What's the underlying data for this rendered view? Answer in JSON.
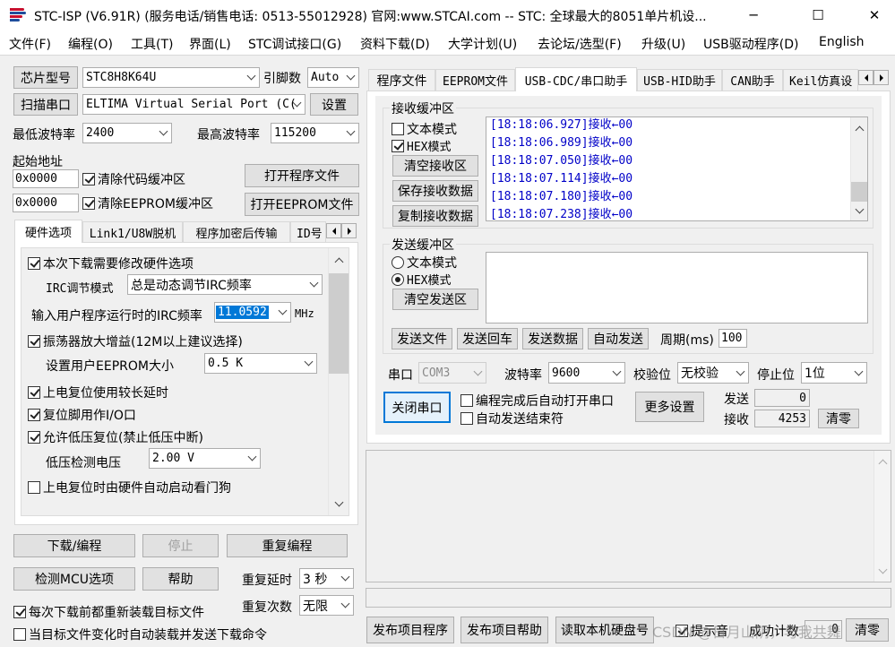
{
  "titlebar": {
    "title": "STC-ISP (V6.91R) (服务电话/销售电话: 0513-55012928) 官网:www.STCAI.com  -- STC: 全球最大的8051单片机设...",
    "minimize": "─",
    "maximize": "☐",
    "close": "✕"
  },
  "menu": [
    "文件(F)",
    "编程(O)",
    "工具(T)",
    "界面(L)",
    "STC调试接口(G)",
    "资料下载(D)",
    "大学计划(U)",
    "去论坛/选型(F)",
    "升级(U)",
    "USB驱动程序(D)",
    "English"
  ],
  "left": {
    "chip_btn": "芯片型号",
    "chip_value": "STC8H8K64U",
    "pin_label": "引脚数",
    "pin_value": "Auto",
    "scan_btn": "扫描串口",
    "port_value": "ELTIMA Virtual Serial Port (C(",
    "settings_btn": "设置",
    "min_baud_label": "最低波特率",
    "min_baud_value": "2400",
    "max_baud_label": "最高波特率",
    "max_baud_value": "115200",
    "start_addr_label": "起始地址",
    "addr1": "0x0000",
    "clear_code_cb": "清除代码缓冲区",
    "open_prog_btn": "打开程序文件",
    "addr2": "0x0000",
    "clear_eeprom_cb": "清除EEPROM缓冲区",
    "open_eeprom_btn": "打开EEPROM文件",
    "tabs": [
      "硬件选项",
      "Link1/U8W脱机",
      "程序加密后传输",
      "ID号"
    ],
    "hw": {
      "opt_modify": "本次下载需要修改硬件选项",
      "irc_mode_label": "IRC调节模式",
      "irc_mode_value": "总是动态调节IRC频率",
      "irc_freq_label": "输入用户程序运行时的IRC频率",
      "irc_freq_value": "11.0592",
      "irc_unit": "MHz",
      "osc_gain": "振荡器放大增益(12M以上建议选择)",
      "eeprom_size_label": "设置用户EEPROM大小",
      "eeprom_size_value": "0.5 K",
      "long_reset": "上电复位使用较长延时",
      "reset_io": "复位脚用作I/O口",
      "lvr": "允许低压复位(禁止低压中断)",
      "lvd_label": "低压检测电压",
      "lvd_value": "2.00 V",
      "wdt": "上电复位时由硬件自动启动看门狗"
    },
    "download_btn": "下载/编程",
    "stop_btn": "停止",
    "reprogram_btn": "重复编程",
    "detect_btn": "检测MCU选项",
    "help_btn": "帮助",
    "repeat_delay_label": "重复延时",
    "repeat_delay_value": "3 秒",
    "repeat_count_label": "重复次数",
    "repeat_count_value": "无限",
    "reload_cb": "每次下载前都重新装载目标文件",
    "autoload_cb": "当目标文件变化时自动装载并发送下载命令"
  },
  "right": {
    "tabs": [
      "程序文件",
      "EEPROM文件",
      "USB-CDC/串口助手",
      "USB-HID助手",
      "CAN助手",
      "Keil仿真设"
    ],
    "rx_group": "接收缓冲区",
    "rx_text_mode": "文本模式",
    "rx_hex_mode": "HEX模式",
    "rx_clear": "清空接收区",
    "rx_save": "保存接收数据",
    "rx_copy": "复制接收数据",
    "rx_log": [
      "[18:18:06.927]接收←00",
      "[18:18:06.989]接收←00",
      "[18:18:07.050]接收←00",
      "[18:18:07.114]接收←00",
      "[18:18:07.180]接收←00",
      "[18:18:07.238]接收←00"
    ],
    "tx_group": "发送缓冲区",
    "tx_text_mode": "文本模式",
    "tx_hex_mode": "HEX模式",
    "tx_clear": "清空发送区",
    "send_file": "发送文件",
    "send_enter": "发送回车",
    "send_data": "发送数据",
    "auto_send": "自动发送",
    "period_label": "周期(ms)",
    "period_value": "100",
    "port_label": "串口",
    "port_value": "COM3",
    "baud_label": "波特率",
    "baud_value": "9600",
    "parity_label": "校验位",
    "parity_value": "无校验",
    "stop_label": "停止位",
    "stop_value": "1位",
    "close_port": "关闭串口",
    "auto_open_cb": "编程完成后自动打开串口",
    "auto_send_end_cb": "自动发送结束符",
    "more_settings": "更多设置",
    "sent_label": "发送",
    "sent_value": "0",
    "recv_label": "接收",
    "recv_value": "4253",
    "clear_counts": "清零",
    "publish_prog": "发布项目程序",
    "publish_help": "发布项目帮助",
    "read_disk": "读取本机硬盘号",
    "prompt_cb": "提示音",
    "success_count": "成功计数",
    "count_value": "0",
    "clear_btn": "清零",
    "watermark": "CSDN @日月山阴，与我共舞"
  }
}
